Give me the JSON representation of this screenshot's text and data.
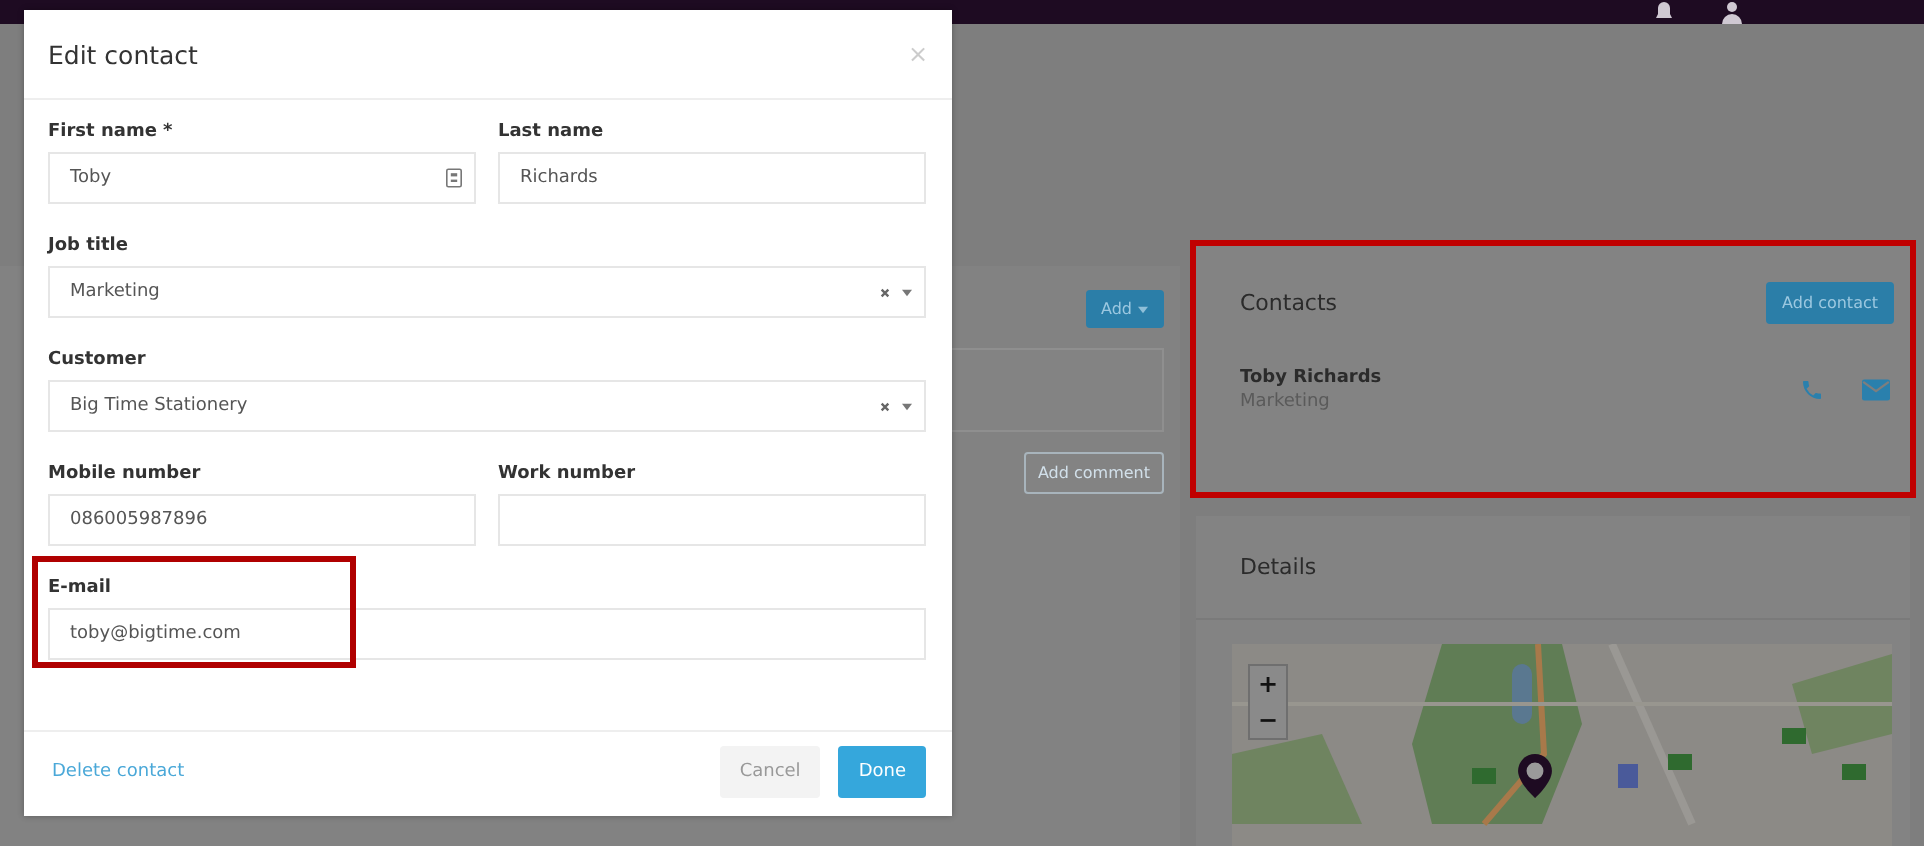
{
  "page": {
    "comments_panel": {
      "add_button": "Add",
      "add_comment_button": "Add comment"
    },
    "contacts_card": {
      "title": "Contacts",
      "add_button": "Add contact",
      "highlighted": true,
      "contacts": [
        {
          "name": "Toby Richards",
          "job_title": "Marketing"
        }
      ]
    },
    "details_card": {
      "title": "Details",
      "map": {
        "kind": "picture",
        "zoom_in": "+",
        "zoom_out": "−"
      }
    }
  },
  "modal": {
    "title": "Edit contact",
    "close": "×",
    "rows": [
      [
        {
          "label": "First name *",
          "kind": "icon-text",
          "value": "Toby",
          "highlighted": false
        },
        {
          "label": "Last name",
          "kind": "text",
          "value": "Richards",
          "highlighted": false
        }
      ],
      [
        {
          "label": "Job title",
          "kind": "select",
          "value": "Marketing",
          "highlighted": false
        }
      ],
      [
        {
          "label": "Customer",
          "kind": "select",
          "value": "Big Time Stationery",
          "highlighted": false
        }
      ],
      [
        {
          "label": "Mobile number",
          "kind": "text",
          "value": "086005987896",
          "highlighted": false
        },
        {
          "label": "Work number",
          "kind": "text",
          "highlighted": false
        }
      ],
      [
        {
          "label": "E-mail",
          "kind": "text",
          "value": "toby@bigtime.com",
          "highlighted": true
        }
      ]
    ],
    "delete_link": "Delete contact",
    "buttons": [
      {
        "label": "Cancel",
        "kind": "secondary"
      },
      {
        "label": "Done",
        "kind": "primary"
      }
    ]
  }
}
